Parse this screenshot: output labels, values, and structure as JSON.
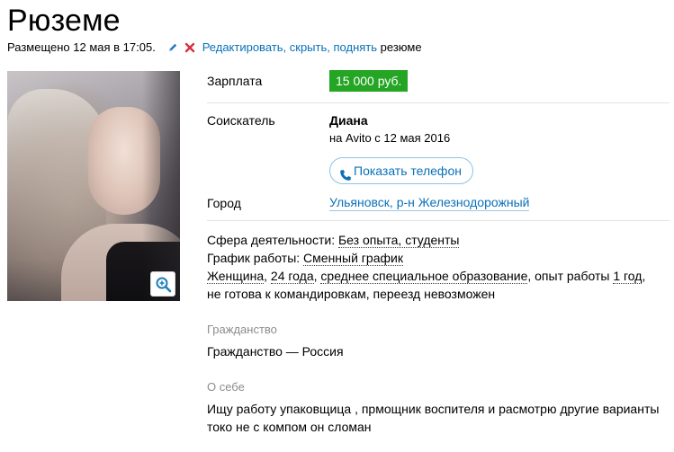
{
  "page": {
    "title": "Рюземе"
  },
  "meta": {
    "posted": "Размещено 12 мая в 17:05.",
    "edit_link": "Редактировать",
    "sep1": ",",
    "hide_link": "скрыть",
    "sep2": ",",
    "raise_link": "поднять",
    "tail": "резюме",
    "icons": [
      "pencil-icon",
      "cross-icon"
    ],
    "colors": {
      "link": "#0a71b8",
      "pencil": "#2a7ac0",
      "cross": "#d7303b"
    }
  },
  "photo": {
    "zoom_icon": "zoom-in-icon"
  },
  "salary": {
    "label": "Зарплата",
    "value": "15 000 руб.",
    "badge_color": "#24a523"
  },
  "seeker": {
    "label": "Соискатель",
    "name": "Диана",
    "since": "на Avito с 12 мая 2016",
    "phone_button": "Показать телефон",
    "phone_icon": "phone-icon"
  },
  "city": {
    "label": "Город",
    "value": "Ульяновск, р-н Железнодорожный"
  },
  "details": {
    "sphere_label": "Сфера деятельности:",
    "sphere_value": "Без опыта, студенты",
    "schedule_label": "График работы:",
    "schedule_value": "Сменный график",
    "gender": "Женщина",
    "comma1": ",",
    "age": "24 года",
    "comma2": ",",
    "education": "среднее специальное образование",
    "exp_prefix": ", опыт работы",
    "experience": "1 год",
    "comma3": ",",
    "line4": "не готова к командировкам, переезд невозможен"
  },
  "citizenship": {
    "heading": "Гражданство",
    "text": "Гражданство — Россия"
  },
  "about": {
    "heading": "О себе",
    "line1": "Ищу работу упаковщица , прмощник воспителя и расмотрю другие варианты",
    "line2": "токо не с компом он сломан"
  }
}
